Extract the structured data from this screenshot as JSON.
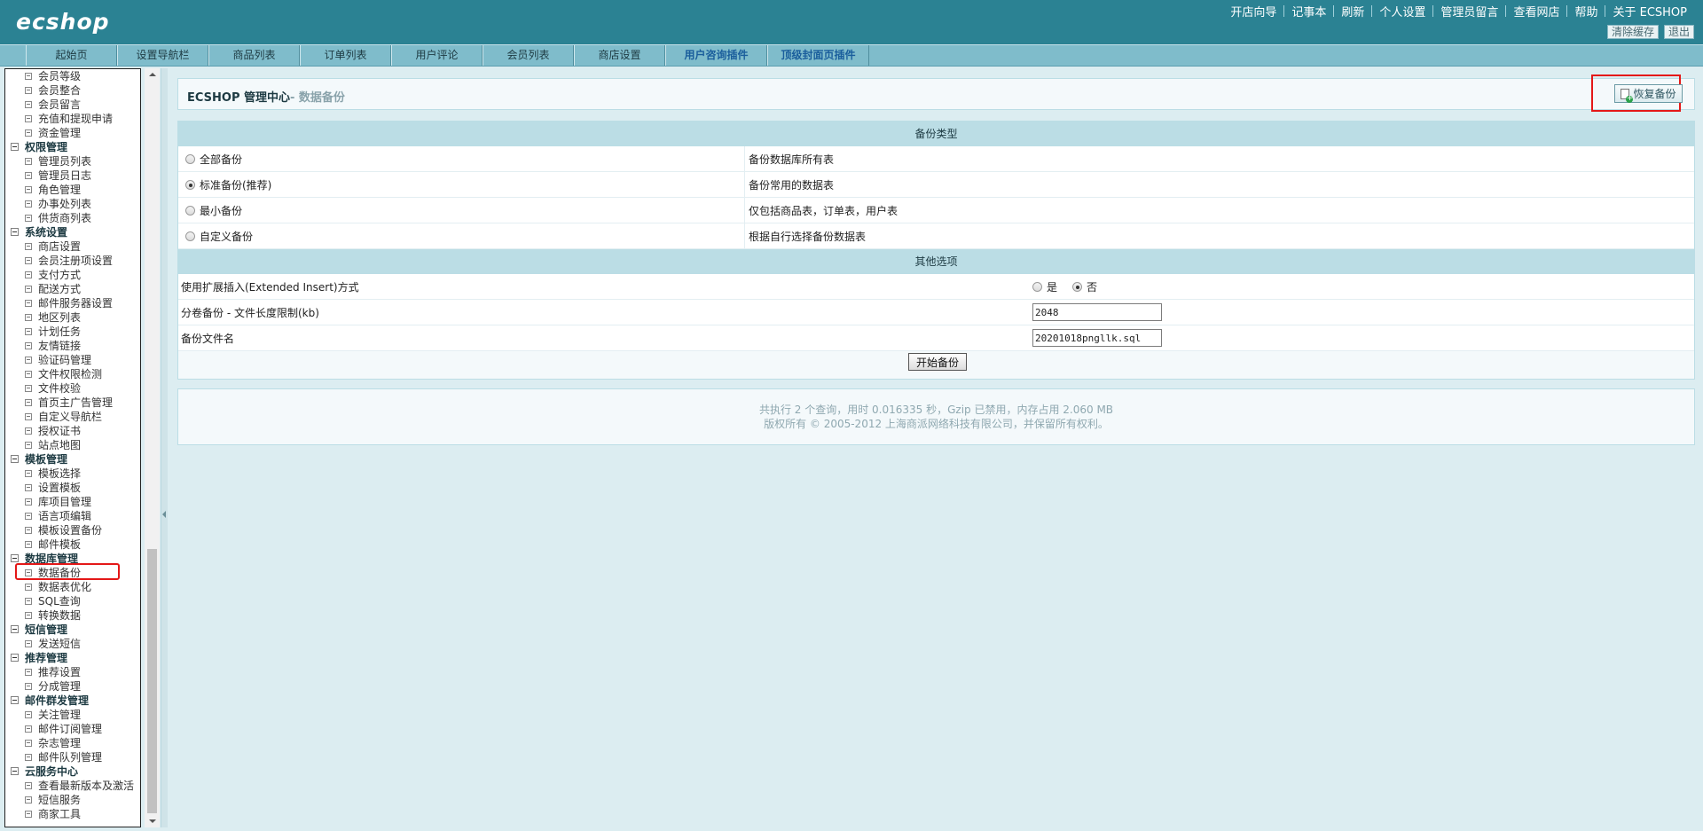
{
  "header": {
    "logo": "ecshop",
    "top_links": [
      "开店向导",
      "记事本",
      "刷新",
      "个人设置",
      "管理员留言",
      "查看网店",
      "帮助",
      "关于 ECSHOP"
    ],
    "buttons": {
      "clear_cache": "清除缓存",
      "logout": "退出"
    }
  },
  "nav": {
    "tabs": [
      "起始页",
      "设置导航栏",
      "商品列表",
      "订单列表",
      "用户评论",
      "会员列表",
      "商店设置"
    ],
    "plugin_tabs": [
      "用户咨询插件",
      "顶级封面页插件"
    ]
  },
  "sidebar": {
    "groups": [
      {
        "title": "",
        "items": [
          "会员等级",
          "会员整合",
          "会员留言",
          "充值和提现申请",
          "资金管理"
        ]
      },
      {
        "title": "权限管理",
        "items": [
          "管理员列表",
          "管理员日志",
          "角色管理",
          "办事处列表",
          "供货商列表"
        ]
      },
      {
        "title": "系统设置",
        "items": [
          "商店设置",
          "会员注册项设置",
          "支付方式",
          "配送方式",
          "邮件服务器设置",
          "地区列表",
          "计划任务",
          "友情链接",
          "验证码管理",
          "文件权限检测",
          "文件校验",
          "首页主广告管理",
          "自定义导航栏",
          "授权证书",
          "站点地图"
        ]
      },
      {
        "title": "模板管理",
        "items": [
          "模板选择",
          "设置模板",
          "库项目管理",
          "语言项编辑",
          "模板设置备份",
          "邮件模板"
        ]
      },
      {
        "title": "数据库管理",
        "items": [
          "数据备份",
          "数据表优化",
          "SQL查询",
          "转换数据"
        ]
      },
      {
        "title": "短信管理",
        "items": [
          "发送短信"
        ]
      },
      {
        "title": "推荐管理",
        "items": [
          "推荐设置",
          "分成管理"
        ]
      },
      {
        "title": "邮件群发管理",
        "items": [
          "关注管理",
          "邮件订阅管理",
          "杂志管理",
          "邮件队列管理"
        ]
      },
      {
        "title": "云服务中心",
        "items": [
          "查看最新版本及激活",
          "短信服务",
          "商家工具"
        ]
      }
    ]
  },
  "main": {
    "title": "ECSHOP 管理中心",
    "subtitle": "- 数据备份",
    "restore_button": "恢复备份",
    "backup_type_header": "备份类型",
    "backup_types": [
      {
        "label": "全部备份",
        "desc": "备份数据库所有表",
        "checked": false
      },
      {
        "label": "标准备份(推荐)",
        "desc": "备份常用的数据表",
        "checked": true
      },
      {
        "label": "最小备份",
        "desc": "仅包括商品表，订单表，用户表",
        "checked": false
      },
      {
        "label": "自定义备份",
        "desc": "根据自行选择备份数据表",
        "checked": false
      }
    ],
    "other_options_header": "其他选项",
    "extended_insert": {
      "label": "使用扩展插入(Extended Insert)方式",
      "yes": "是",
      "no": "否",
      "selected": "no"
    },
    "volume_size": {
      "label": "分卷备份 - 文件长度限制(kb)",
      "value": "2048"
    },
    "file_name": {
      "label": "备份文件名",
      "value": "20201018pngllk.sql"
    },
    "start_button": "开始备份"
  },
  "footer": {
    "line1": "共执行 2 个查询，用时 0.016335 秒，Gzip 已禁用，内存占用 2.060 MB",
    "line2": "版权所有 © 2005-2012 上海商派网络科技有限公司，并保留所有权利。"
  },
  "colors": {
    "header_bg": "#2b8293",
    "nav_bg": "#7fbccb",
    "page_bg": "#dcedf1",
    "section_header": "#bbdde5",
    "highlight_red": "#e41818"
  }
}
